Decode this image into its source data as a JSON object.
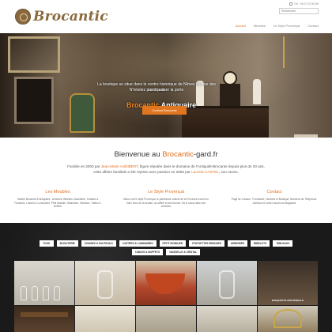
{
  "header": {
    "logo_text": "Brocantic",
    "phone": "Tél : 06 07 02 60 89",
    "search_placeholder": "Rechercher",
    "nav": [
      "Accueil",
      "Meubles",
      "Le Style Provençal",
      "Contact"
    ]
  },
  "hero": {
    "brand": "Brocantic",
    "title_rest": " Antiquaire",
    "line1": "La boutique se situe dans le centre historique de Nîmes 29, rue des Lombards",
    "line2": "N'hésitez pas à passer la porte",
    "button": "Contact Brocantic"
  },
  "welcome": {
    "prefix": "Bienvenue au ",
    "brand": "Brocantic",
    "suffix": "-gard.fr",
    "p1_a": "Fondée en 2000 par ",
    "p1_name": "Jean-Marie AUDIBERT",
    "p1_b": ", figure réputée dans le domaine de l'Antiquité-Brocante depuis plus de 30 ans,",
    "p2_a": "cette affaire familiale a été reprise avec passion en 2006 par ",
    "p2_name": "Laurent CASTEL",
    "p2_b": ", son neveu."
  },
  "columns": [
    {
      "title": "Les Meubles",
      "text": "Galerie Brocante & Antiquités : Armoires, Bibelots, Buanderie, Chaises & Fauteuils, Lustres & Luminaires, Petit Mobilier, Statuettes, Tableaux, Tables & Buffets"
    },
    {
      "title": "Le Style Provençal",
      "text": "Mieux voir le style Provençal, le patrimoine culturel de la Provence trouvé un écrin chez de la beauté, du raffiné et des formes. Sa le savoir-faire des ancêtres"
    },
    {
      "title": "Contact",
      "text": "Page de Contact : Formulaire, Horaires et Boutique, Numéros de Téléphone, Adresse et Carte d'accès au Magasine"
    }
  ],
  "filters": [
    "TOUS",
    "BIJOUTERIE",
    "CHAISES & FAUTEUILS",
    "LUSTRES & LUMINAIRES",
    "PETIT MOBILIER",
    "STATUETTES BRONZES",
    "ARMOIRES",
    "BIBELOTS",
    "TABLEAUX",
    "TABLES & BUFFETS",
    "VAISSELLE & CRISTAL"
  ],
  "gallery_caption": "BANQUETTE PROVENÇALE"
}
